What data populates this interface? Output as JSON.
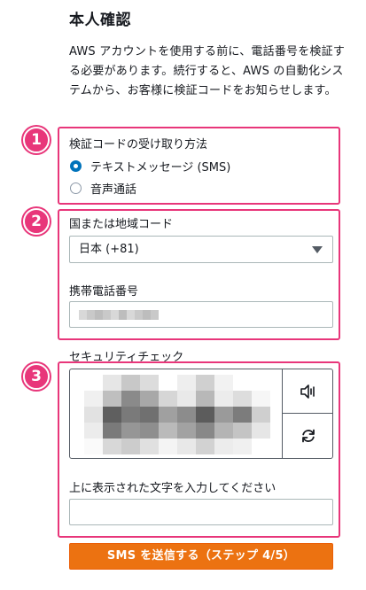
{
  "page": {
    "title": "本人確認",
    "description": "AWS アカウントを使用する前に、電話番号を検証する必要があります。続行すると、AWS の自動化システムから、お客様に検証コードをお知らせします。"
  },
  "steps": {
    "step1": "1",
    "step2": "2",
    "step3": "3"
  },
  "verification_method": {
    "label": "検証コードの受け取り方法",
    "options": [
      {
        "label": "テキストメッセージ (SMS)",
        "selected": true
      },
      {
        "label": "音声通話",
        "selected": false
      }
    ]
  },
  "country": {
    "label": "国または地域コード",
    "selected": "日本 (+81)"
  },
  "phone": {
    "label": "携帯電話番号",
    "value_blurred": true
  },
  "security_check": {
    "label": "セキュリティチェック",
    "audio_icon": "speaker-icon",
    "refresh_icon": "refresh-icon",
    "input_label": "上に表示された文字を入力してください",
    "input_value": "",
    "image_blurred": true
  },
  "submit": {
    "label": "SMS を送信する（ステップ 4/5）"
  },
  "colors": {
    "highlight": "#e8367a",
    "accent": "#0073bb",
    "submit": "#ec7211"
  }
}
